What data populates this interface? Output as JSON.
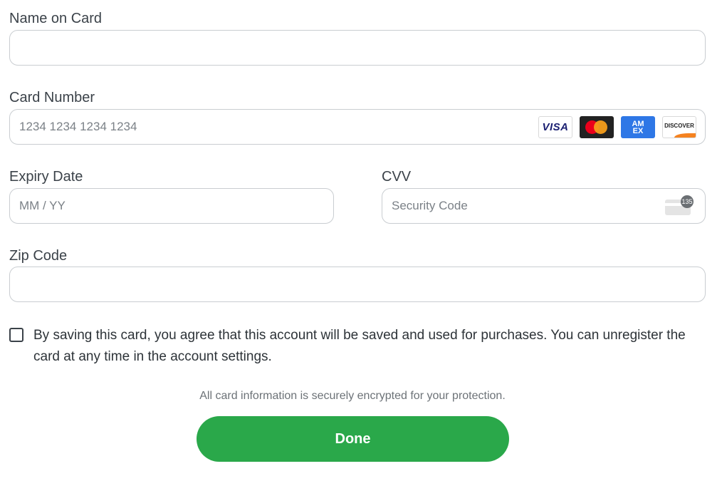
{
  "name_on_card": {
    "label": "Name on Card",
    "value": "",
    "placeholder": ""
  },
  "card_number": {
    "label": "Card Number",
    "value": "",
    "placeholder": "1234 1234 1234 1234",
    "logos": {
      "visa": "VISA",
      "amex_line1": "AM",
      "amex_line2": "EX",
      "discover": "DISCOVER"
    }
  },
  "expiry": {
    "label": "Expiry Date",
    "value": "",
    "placeholder": "MM / YY"
  },
  "cvv": {
    "label": "CVV",
    "value": "",
    "placeholder": "Security Code",
    "icon_badge": "135"
  },
  "zip": {
    "label": "Zip Code",
    "value": "",
    "placeholder": ""
  },
  "save_card": {
    "checked": false,
    "text": "By saving this card, you agree that this account will be saved and used for purchases. You can unregister the card at any time in the account settings."
  },
  "secure_note": "All card information is securely encrypted for your protection.",
  "done_label": "Done",
  "colors": {
    "primary": "#2aa84a",
    "border": "#c9cdd1",
    "text": "#3b4249"
  }
}
